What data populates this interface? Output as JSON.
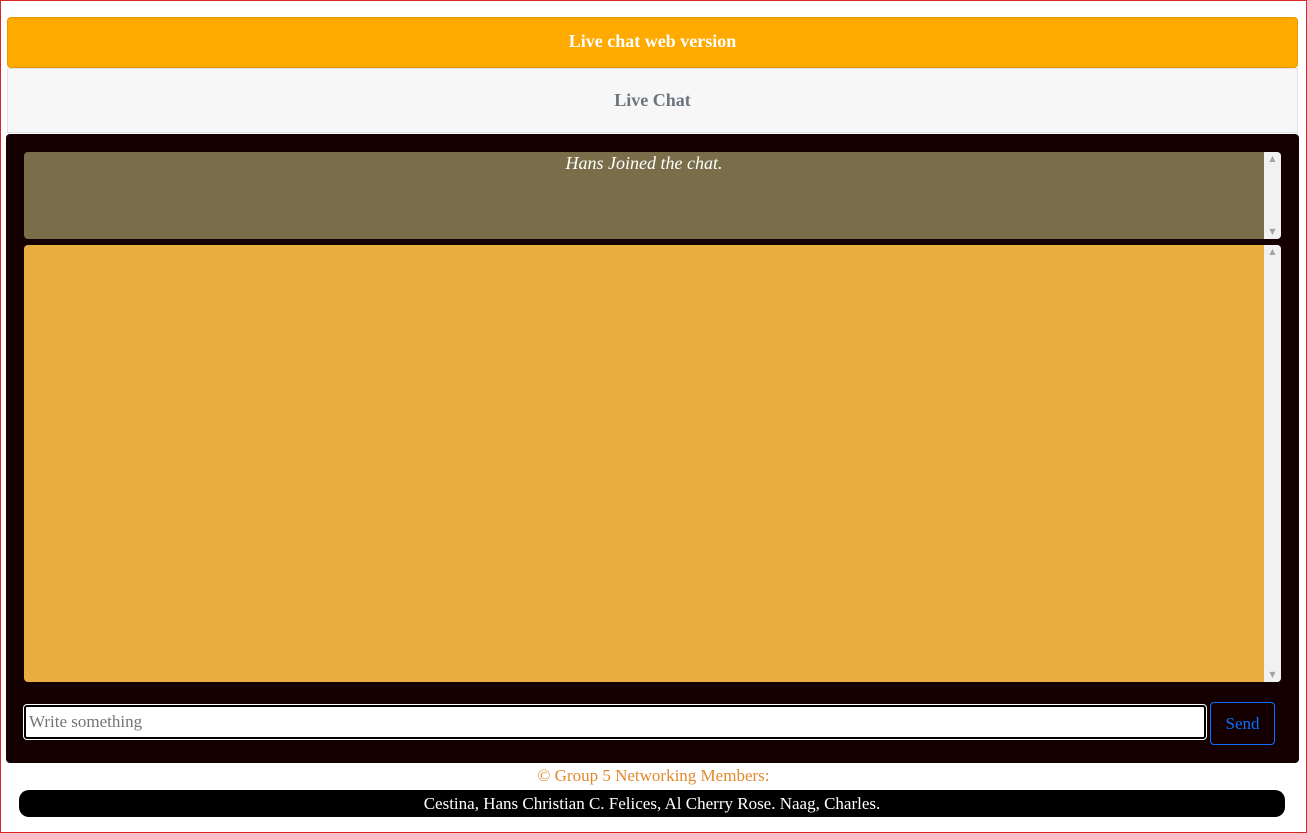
{
  "header": {
    "title": "Live chat web version",
    "subtitle": "Live Chat"
  },
  "chat": {
    "notices": [
      "Hans Joined the chat."
    ],
    "messages": [],
    "input_placeholder": "Write something",
    "input_value": "",
    "send_label": "Send"
  },
  "footer": {
    "credit": "© Group 5 Networking Members:",
    "members": "Cestina, Hans Christian C. Felices, Al Cherry Rose. Naag, Charles."
  },
  "colors": {
    "top_bar": "#ffaa00",
    "chat_panel": "#140001",
    "notice_box": "#7a6e4a",
    "messages_box": "#e9ae42",
    "send_button": "#0d6efd",
    "footer_credit": "#e08a2f"
  }
}
